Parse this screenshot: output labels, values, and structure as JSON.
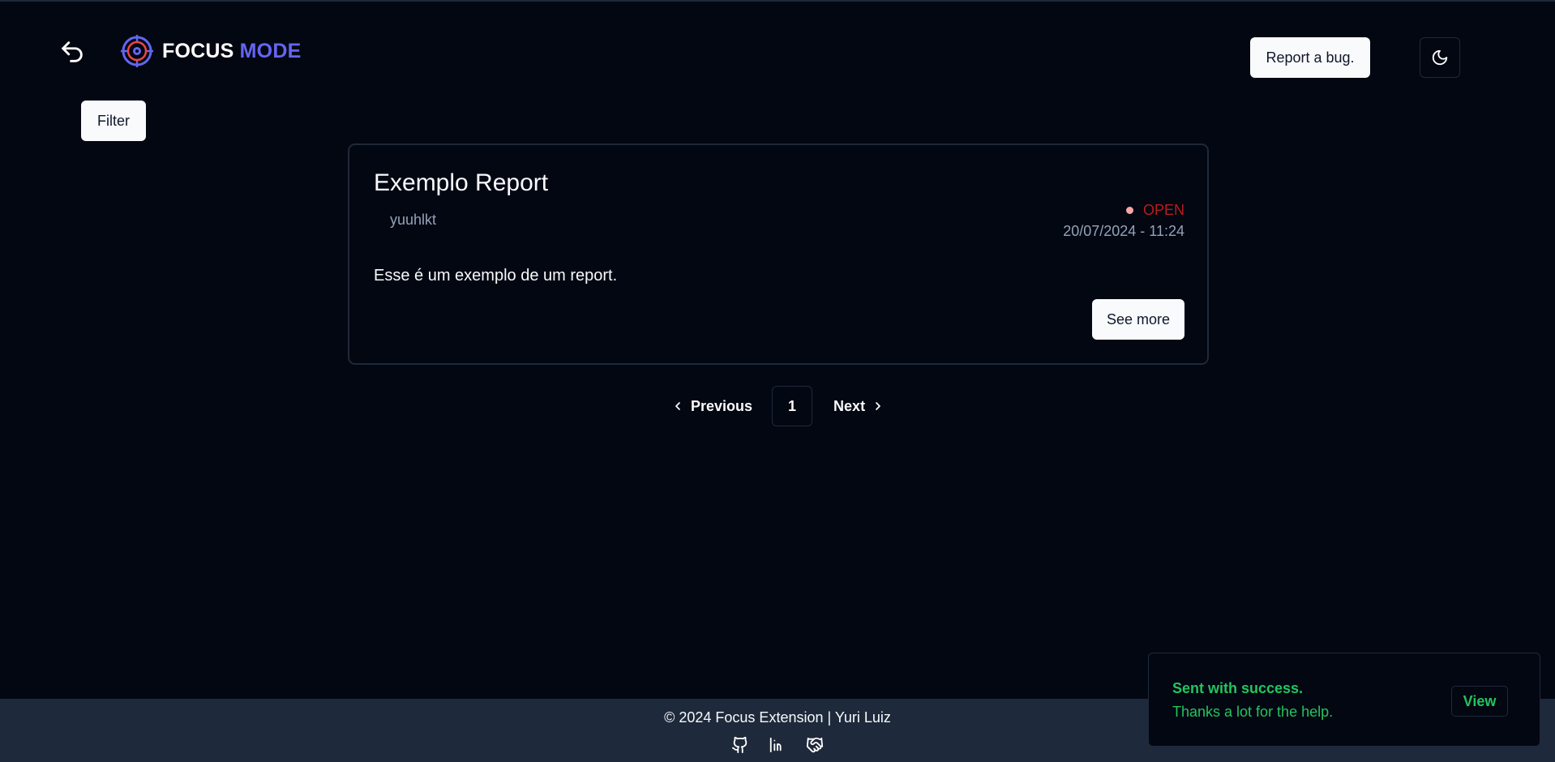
{
  "header": {
    "logo_word1": "FOCUS",
    "logo_word2": "MODE",
    "report_bug_label": "Report a bug.",
    "back_icon": "undo-arrow-icon",
    "theme_icon": "moon-icon",
    "logo_icon": "target-eye-icon"
  },
  "filter": {
    "label": "Filter"
  },
  "reports": [
    {
      "title": "Exemplo Report",
      "author": "yuuhlkt",
      "status": "OPEN",
      "datetime": "20/07/2024 - 11:24",
      "description": "Esse é um exemplo de um report.",
      "see_more_label": "See more"
    }
  ],
  "pagination": {
    "previous_label": "Previous",
    "current_page": "1",
    "next_label": "Next"
  },
  "footer": {
    "copyright": "© 2024 Focus Extension | Yuri Luiz",
    "icons": [
      "github-icon",
      "linkedin-icon",
      "handshake-icon"
    ]
  },
  "toast": {
    "title": "Sent with success.",
    "description": "Thanks a lot for the help.",
    "action_label": "View"
  },
  "colors": {
    "background": "#030712",
    "accent": "#6366f1",
    "status_open": "#b91c1c",
    "success": "#22c55e",
    "footer_bg": "#1e293b"
  }
}
